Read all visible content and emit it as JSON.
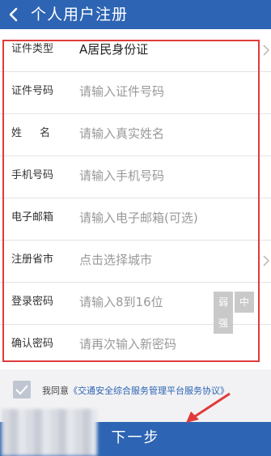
{
  "header": {
    "title": "个人用户注册"
  },
  "form": {
    "rows": [
      {
        "label": "证件类型",
        "value": "A居民身份证"
      },
      {
        "label": "证件号码",
        "placeholder": "请输入证件号码"
      },
      {
        "label": "姓名",
        "placeholder": "请输入真实姓名"
      },
      {
        "label": "手机号码",
        "placeholder": "请输入手机号码"
      },
      {
        "label": "电子邮箱",
        "placeholder": "请输入电子邮箱(可选)"
      },
      {
        "label": "注册省市",
        "placeholder": "点击选择城市"
      },
      {
        "label": "登录密码",
        "placeholder": "请输入8到16位"
      },
      {
        "label": "确认密码",
        "placeholder": "请再次输入新密码"
      }
    ],
    "strength": [
      "弱",
      "中",
      "强"
    ]
  },
  "agreement": {
    "prefix": "我同意",
    "link": "《交通安全综合服务管理平台服务协议》"
  },
  "next_button": "下一步",
  "colors": {
    "primary": "#2d64b3",
    "highlight": "#e03b3b"
  }
}
